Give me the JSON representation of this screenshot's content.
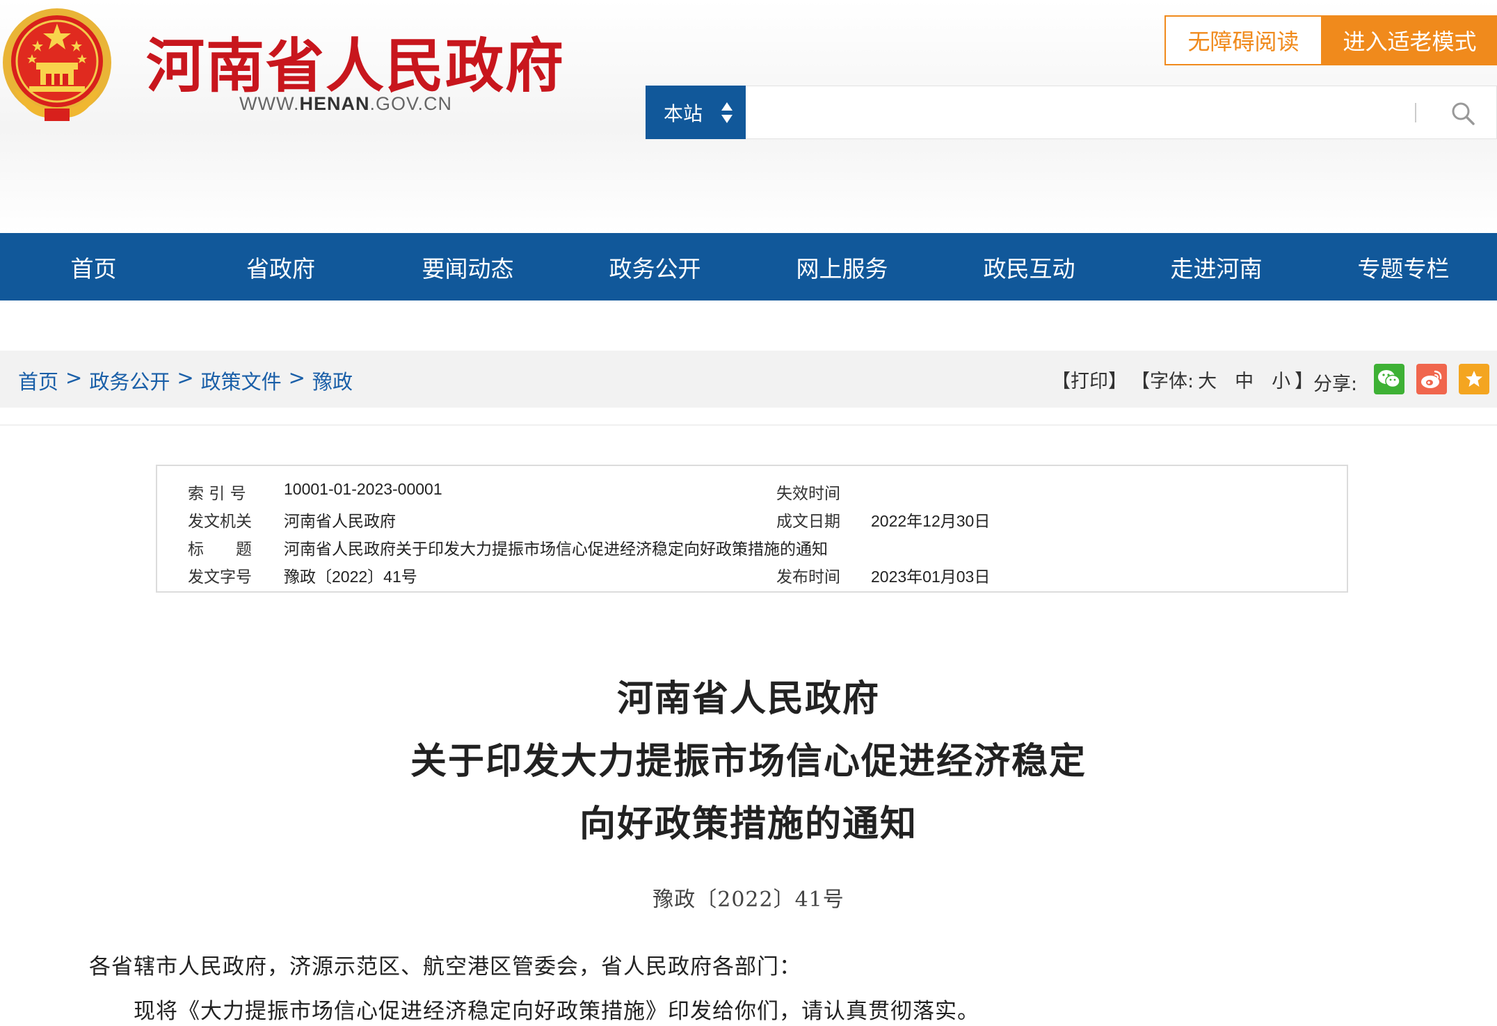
{
  "header": {
    "site_title": "河南省人民政府",
    "url_prefix": "WWW.",
    "url_highlight": "HENAN",
    "url_suffix": ".GOV.CN",
    "accessible_button": "无障碍阅读",
    "elder_mode_button": "进入适老模式",
    "search_scope": "本站",
    "search_placeholder": "",
    "brand_red": "#c8161d",
    "accent_orange": "#f08a1c",
    "nav_blue": "#11589a"
  },
  "nav": {
    "items": [
      {
        "label": "首页"
      },
      {
        "label": "省政府"
      },
      {
        "label": "要闻动态"
      },
      {
        "label": "政务公开"
      },
      {
        "label": "网上服务"
      },
      {
        "label": "政民互动"
      },
      {
        "label": "走进河南"
      },
      {
        "label": "专题专栏"
      }
    ]
  },
  "breadcrumb": {
    "items": [
      "首页",
      "政务公开",
      "政策文件",
      "豫政"
    ],
    "separator": ">"
  },
  "tools": {
    "print": "【打印】",
    "font_label": "【字体:",
    "font_large": "大",
    "font_medium": "中",
    "font_small": "小",
    "font_close": "】",
    "share_label": "分享:",
    "share_icons": [
      "wechat-icon",
      "weibo-icon",
      "favorite-icon"
    ]
  },
  "meta": {
    "index_label": "索 引 号",
    "index_value": "10001-01-2023-00001",
    "expire_label": "失效时间",
    "expire_value": "",
    "issuer_label": "发文机关",
    "issuer_value": "河南省人民政府",
    "created_label": "成文日期",
    "created_value": "2022年12月30日",
    "title_label": "标　　题",
    "title_value": "河南省人民政府关于印发大力提振市场信心促进经济稳定向好政策措施的通知",
    "docno_label": "发文字号",
    "docno_value": "豫政〔2022〕41号",
    "published_label": "发布时间",
    "published_value": "2023年01月03日"
  },
  "article": {
    "title_line1": "河南省人民政府",
    "title_line2": "关于印发大力提振市场信心促进经济稳定",
    "title_line3": "向好政策措施的通知",
    "doc_number": "豫政〔2022〕41号",
    "recipients": "各省辖市人民政府，济源示范区、航空港区管委会，省人民政府各部门：",
    "body_p1": "现将《大力提振市场信心促进经济稳定向好政策措施》印发给你们，请认真贯彻落实。"
  }
}
